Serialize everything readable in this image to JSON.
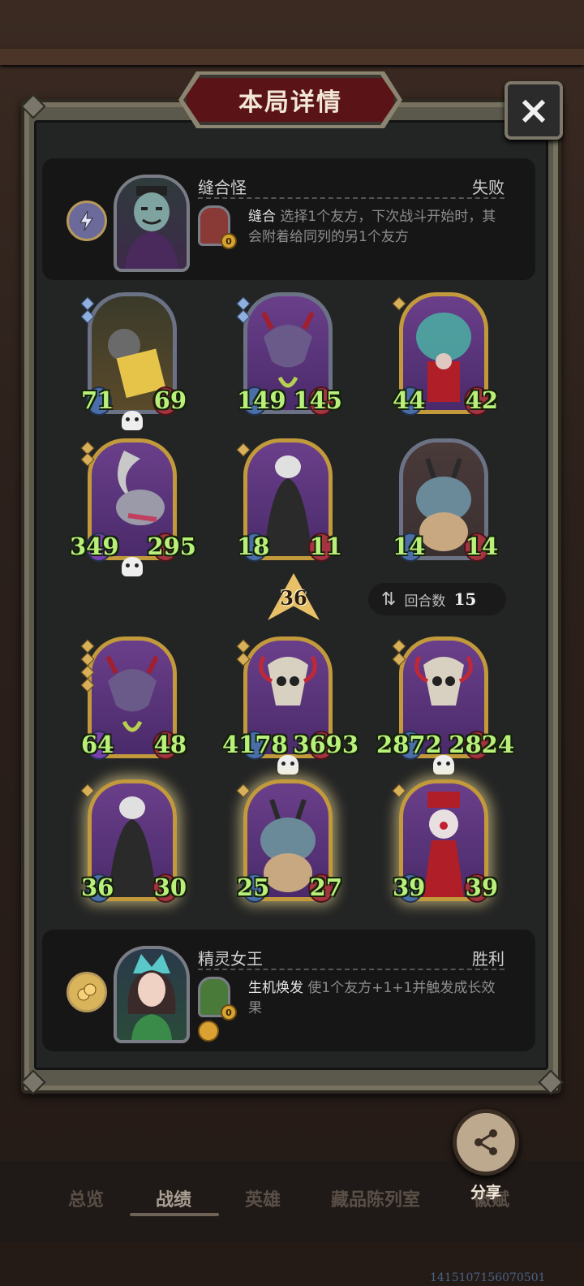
{
  "title": "本局详情",
  "close_icon": "×",
  "opponent": {
    "name": "缝合怪",
    "result": "失败",
    "skill_name": "缝合",
    "skill_text": "选择1个友方，下次战斗开始时，其会附着给同列的另1个友方",
    "skill_cost": "0"
  },
  "player": {
    "name": "精灵女王",
    "result": "胜利",
    "skill_name": "生机焕发",
    "skill_text": "使1个友方+1+1并触发成长效果",
    "skill_cost": "0"
  },
  "level": "36",
  "turn": {
    "label": "回合数",
    "value": "15"
  },
  "enemy_cards": [
    {
      "atk": "71",
      "hp": "69"
    },
    {
      "atk": "149",
      "hp": "145"
    },
    {
      "atk": "44",
      "hp": "42"
    },
    {
      "atk": "349",
      "hp": "295"
    },
    {
      "atk": "18",
      "hp": "11"
    },
    {
      "atk": "14",
      "hp": "14"
    }
  ],
  "ally_cards": [
    {
      "atk": "64",
      "hp": "48"
    },
    {
      "atk": "4178",
      "hp": "3693"
    },
    {
      "atk": "2872",
      "hp": "2824"
    },
    {
      "atk": "36",
      "hp": "30"
    },
    {
      "atk": "25",
      "hp": "27"
    },
    {
      "atk": "39",
      "hp": "39"
    }
  ],
  "share_label": "分享",
  "nav": [
    "总览",
    "战绩",
    "英雄",
    "藏品陈列室",
    "徽赋"
  ],
  "footer_id": "1415107156070501"
}
